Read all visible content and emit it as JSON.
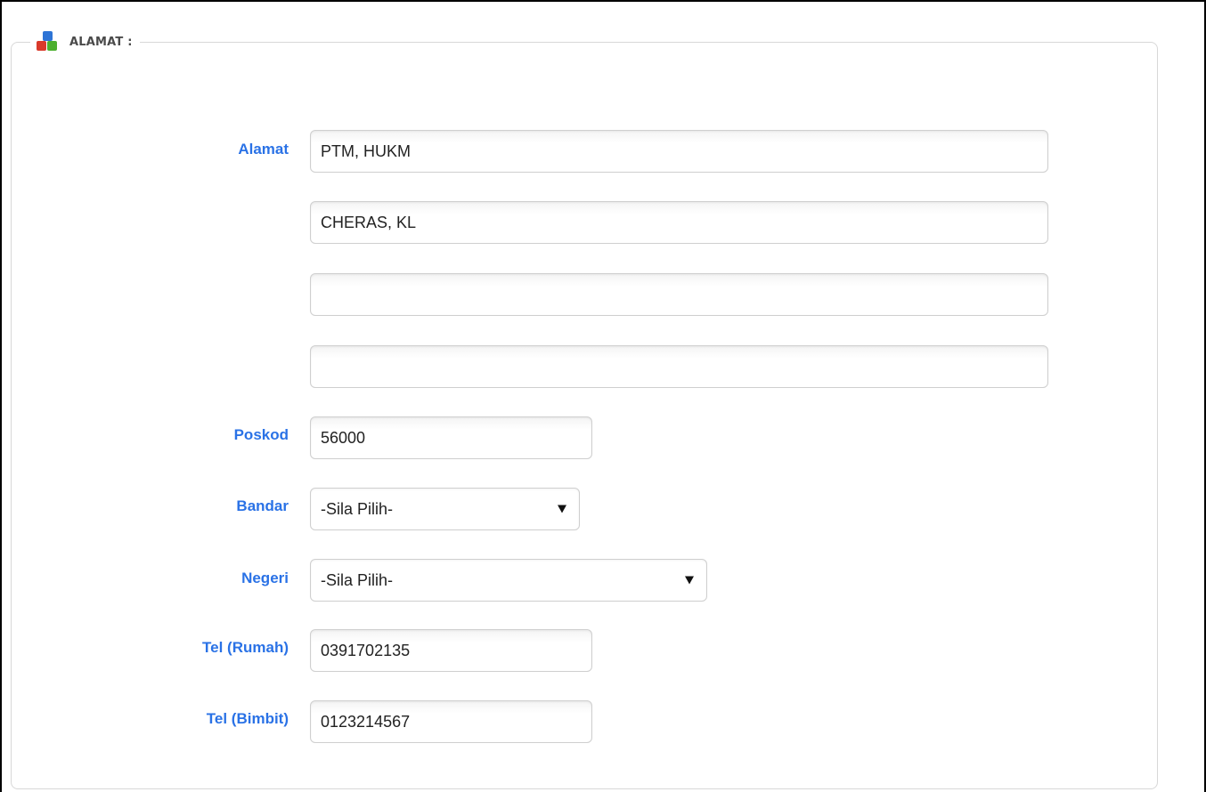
{
  "section": {
    "title": "ALAMAT :"
  },
  "form": {
    "alamat_label": "Alamat",
    "alamat1": "PTM, HUKM",
    "alamat2": "CHERAS, KL",
    "alamat3": "",
    "alamat4": "",
    "poskod_label": "Poskod",
    "poskod": "56000",
    "bandar_label": "Bandar",
    "bandar_selected": "-Sila Pilih-",
    "negeri_label": "Negeri",
    "negeri_selected": "-Sila Pilih-",
    "tel_rumah_label": "Tel (Rumah)",
    "tel_rumah": "0391702135",
    "tel_bimbit_label": "Tel (Bimbit)",
    "tel_bimbit": "0123214567"
  },
  "icons": {
    "section_icon": "blocks-icon",
    "dropdown_icon": "caret-down-icon"
  },
  "colors": {
    "label": "#2a72e6",
    "border": "#cfcfcf"
  }
}
